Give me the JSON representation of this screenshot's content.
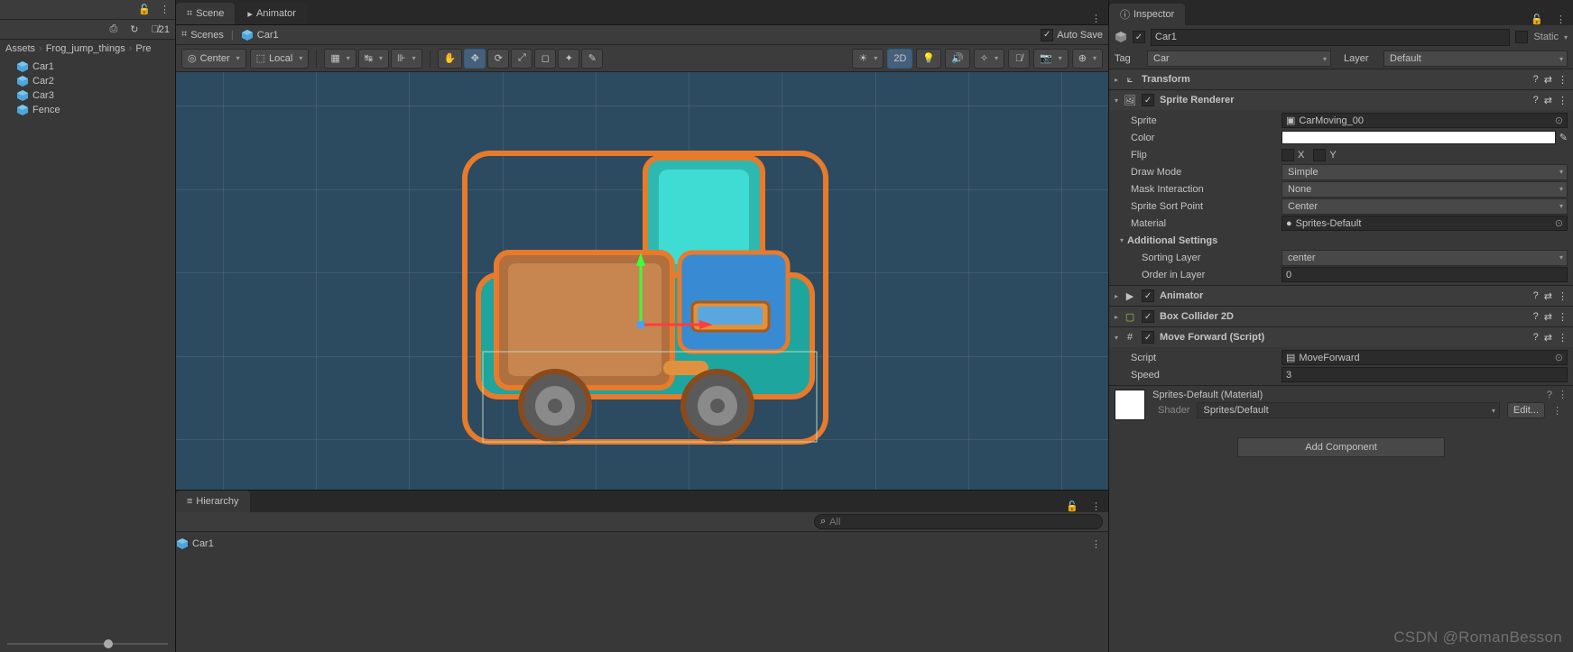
{
  "left": {
    "toolbar": {
      "save_icon": "save",
      "hidden_count": "21"
    },
    "breadcrumb": [
      "Assets",
      "Frog_jump_things",
      "Pre"
    ],
    "items": [
      "Car1",
      "Car2",
      "Car3",
      "Fence"
    ]
  },
  "scene": {
    "tabs": [
      {
        "label": "Scene",
        "active": true
      },
      {
        "label": "Animator",
        "active": false
      }
    ],
    "breadcrumb_icon": "Scenes",
    "breadcrumb_item": "Car1",
    "autosave": "Auto Save",
    "toolbtns": {
      "pivot": "Center",
      "space": "Local",
      "mode2d": "2D"
    }
  },
  "hierarchy": {
    "tab": "Hierarchy",
    "search_placeholder": "All",
    "item": "Car1"
  },
  "inspector": {
    "tab": "Inspector",
    "object_name": "Car1",
    "static_label": "Static",
    "tag_label": "Tag",
    "tag_value": "Car",
    "layer_label": "Layer",
    "layer_value": "Default",
    "components": {
      "transform": {
        "title": "Transform"
      },
      "sprite_renderer": {
        "title": "Sprite Renderer",
        "props": {
          "sprite_label": "Sprite",
          "sprite_value": "CarMoving_00",
          "color_label": "Color",
          "flip_label": "Flip",
          "flip_x": "X",
          "flip_y": "Y",
          "draw_mode_label": "Draw Mode",
          "draw_mode_value": "Simple",
          "mask_label": "Mask Interaction",
          "mask_value": "None",
          "sort_point_label": "Sprite Sort Point",
          "sort_point_value": "Center",
          "material_label": "Material",
          "material_value": "Sprites-Default",
          "additional_label": "Additional Settings",
          "sorting_layer_label": "Sorting Layer",
          "sorting_layer_value": "center",
          "order_label": "Order in Layer",
          "order_value": "0"
        }
      },
      "animator": {
        "title": "Animator"
      },
      "box_collider": {
        "title": "Box Collider 2D"
      },
      "move_forward": {
        "title": "Move Forward (Script)",
        "script_label": "Script",
        "script_value": "MoveForward",
        "speed_label": "Speed",
        "speed_value": "3"
      }
    },
    "material": {
      "title": "Sprites-Default (Material)",
      "shader_label": "Shader",
      "shader_value": "Sprites/Default",
      "edit": "Edit..."
    },
    "add_component": "Add Component"
  },
  "watermark": "CSDN @RomanBesson"
}
